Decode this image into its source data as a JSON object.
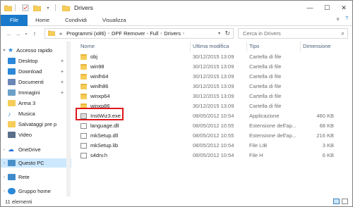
{
  "window": {
    "title": "Drivers",
    "controls": {
      "minimize": "—",
      "maximize": "☐",
      "close": "✕"
    }
  },
  "ribbon": {
    "tabs": [
      "File",
      "Home",
      "Condividi",
      "Visualizza"
    ],
    "expand": "∨",
    "help": "?"
  },
  "address": {
    "path": [
      "Programmi (x86)",
      "DPF Remover - Full",
      "Drivers"
    ],
    "prefix": "«",
    "search_placeholder": "Cerca in Drivers"
  },
  "nav": {
    "items": [
      {
        "label": "Accesso rapido",
        "icon": "star-icon",
        "color": "#2b88d8"
      },
      {
        "label": "Desktop",
        "icon": "desktop-icon",
        "color": "#2b88d8",
        "pinned": true
      },
      {
        "label": "Download",
        "icon": "download-icon",
        "color": "#2b88d8",
        "pinned": true
      },
      {
        "label": "Documenti",
        "icon": "documents-icon",
        "color": "#6a87b5",
        "pinned": true
      },
      {
        "label": "Immagini",
        "icon": "pictures-icon",
        "color": "#6aa0c8",
        "pinned": true
      },
      {
        "label": "Arma 3",
        "icon": "folder-icon",
        "color": "#f6cd59"
      },
      {
        "label": "Musica",
        "icon": "music-icon",
        "color": "#3f8ac9"
      },
      {
        "label": "Salvataggi pre p",
        "icon": "folder-icon",
        "color": "#f6cd59"
      },
      {
        "label": "Video",
        "icon": "video-icon",
        "color": "#5a6f8a"
      },
      {
        "label": "OneDrive",
        "icon": "onedrive-icon",
        "color": "#2b78d8"
      },
      {
        "label": "Questo PC",
        "icon": "pc-icon",
        "color": "#4a90c8"
      },
      {
        "label": "Rete",
        "icon": "network-icon",
        "color": "#3f8ac9"
      },
      {
        "label": "Gruppo home",
        "icon": "homegroup-icon",
        "color": "#2b88d8"
      }
    ],
    "pin_glyph": "📌"
  },
  "columns": {
    "name": "Nome",
    "date": "Ultima modifica",
    "type": "Tipo",
    "size": "Dimensione"
  },
  "files": [
    {
      "name": "obj",
      "date": "30/12/2015 13:09",
      "type": "Cartella di file",
      "size": "",
      "kind": "folder"
    },
    {
      "name": "win98",
      "date": "30/12/2015 13:09",
      "type": "Cartella di file",
      "size": "",
      "kind": "folder"
    },
    {
      "name": "winlh64",
      "date": "30/12/2015 13:09",
      "type": "Cartella di file",
      "size": "",
      "kind": "folder"
    },
    {
      "name": "winlh86",
      "date": "30/12/2015 13:09",
      "type": "Cartella di file",
      "size": "",
      "kind": "folder"
    },
    {
      "name": "winxp64",
      "date": "30/12/2015 13:09",
      "type": "Cartella di file",
      "size": "",
      "kind": "folder"
    },
    {
      "name": "winxp86",
      "date": "30/12/2015 13:09",
      "type": "Cartella di file",
      "size": "",
      "kind": "folder"
    },
    {
      "name": "InstWiz3.exe",
      "date": "08/05/2012 10:54",
      "type": "Applicazione",
      "size": "460 KB",
      "kind": "exe"
    },
    {
      "name": "language.dll",
      "date": "08/05/2012 10:55",
      "type": "Estensione dell'ap...",
      "size": "68 KB",
      "kind": "dll"
    },
    {
      "name": "mkSetup.dll",
      "date": "08/05/2012 10:55",
      "type": "Estensione dell'ap...",
      "size": "216 KB",
      "kind": "dll"
    },
    {
      "name": "mkSetup.lib",
      "date": "08/05/2012 10:54",
      "type": "File LIB",
      "size": "3 KB",
      "kind": "doc"
    },
    {
      "name": "s4drv.h",
      "date": "08/05/2012 10:54",
      "type": "File H",
      "size": "6 KB",
      "kind": "doc"
    }
  ],
  "status": {
    "count": "11 elementi"
  },
  "colors": {
    "accent": "#1979ca",
    "highlight": "#e0161d",
    "selected_bg": "#cce8ff"
  }
}
